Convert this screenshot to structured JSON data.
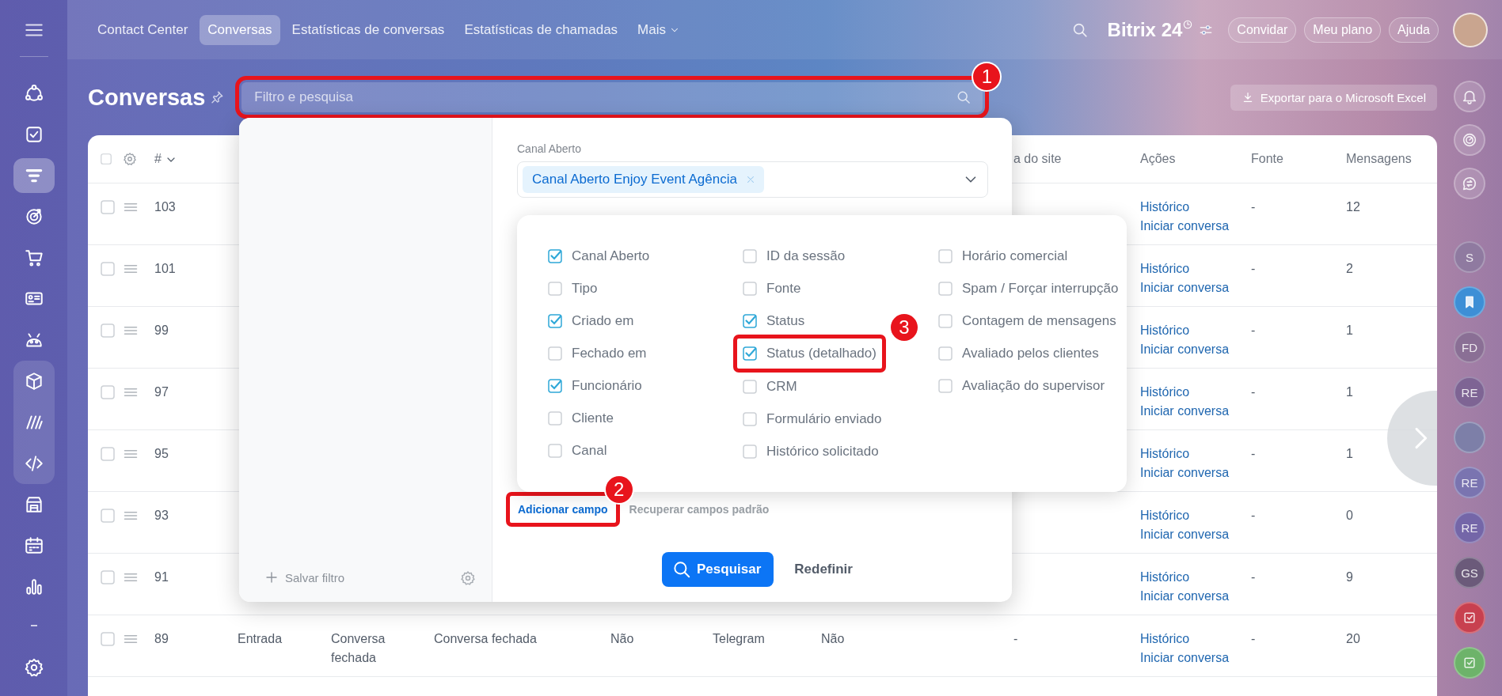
{
  "top_bar": {
    "tabs": [
      {
        "label": "Contact Center",
        "selected": false,
        "kind": "tab"
      },
      {
        "label": "Conversas",
        "selected": true,
        "kind": "tab"
      },
      {
        "label": "Estatísticas de conversas",
        "selected": false,
        "kind": "tab"
      },
      {
        "label": "Estatísticas de chamadas",
        "selected": false,
        "kind": "tab"
      },
      {
        "label": "Mais",
        "selected": false,
        "kind": "menu"
      }
    ],
    "logo": "Bitrix 24",
    "buttons": [
      "Convidar",
      "Meu plano",
      "Ajuda"
    ]
  },
  "left_sidebar": {
    "items": [
      {
        "selected": false,
        "grouped": false
      },
      {
        "selected": false,
        "grouped": false
      },
      {
        "selected": true,
        "grouped": false
      },
      {
        "selected": false,
        "grouped": false
      },
      {
        "selected": false,
        "grouped": false
      },
      {
        "selected": false,
        "grouped": false
      },
      {
        "selected": false,
        "grouped": false
      },
      {
        "selected": false,
        "grouped": true
      },
      {
        "selected": false,
        "grouped": true
      },
      {
        "selected": false,
        "grouped": true
      },
      {
        "selected": false,
        "grouped": false
      },
      {
        "selected": false,
        "grouped": false
      },
      {
        "selected": false,
        "grouped": false
      }
    ]
  },
  "right_sidebar": {
    "items": [
      {
        "kind": "bell"
      },
      {
        "kind": "swirl"
      },
      {
        "kind": "chat"
      },
      {
        "kind": "initials",
        "text": "S",
        "color": "#8f7aa0"
      },
      {
        "kind": "bookmark",
        "color": "#3d8fd6"
      },
      {
        "kind": "initials",
        "text": "FD",
        "color": "#8a6f95"
      },
      {
        "kind": "initials",
        "text": "RE",
        "color": "#7e6494"
      },
      {
        "kind": "photo",
        "color": "#7d7fa8"
      },
      {
        "kind": "initials",
        "text": "RE",
        "color": "#7a74b0"
      },
      {
        "kind": "initials",
        "text": "RE",
        "color": "#7466a8"
      },
      {
        "kind": "initials",
        "text": "GS",
        "color": "#6b5a7a"
      },
      {
        "kind": "task",
        "color": "#c8404f"
      },
      {
        "kind": "task",
        "color": "#6db36a"
      }
    ]
  },
  "page_header": {
    "title": "Conversas",
    "filter": {
      "placeholder": "Filtro e pesquisa",
      "callout": "1"
    },
    "export_button": "Exportar para o Microsoft Excel"
  },
  "table": {
    "select_all": {
      "checked": false
    },
    "columns": [
      "#",
      "a do site",
      "Ações",
      "Fonte",
      "Mensagens"
    ],
    "rows": [
      {
        "selected": false,
        "number": "103",
        "actions": [
          "Histórico",
          "Iniciar conversa"
        ],
        "source": "-",
        "messages": "12"
      },
      {
        "selected": false,
        "number": "101",
        "actions": [
          "Histórico",
          "Iniciar conversa"
        ],
        "source": "-",
        "messages": "2"
      },
      {
        "selected": false,
        "number": "99",
        "actions": [
          "Histórico",
          "Iniciar conversa"
        ],
        "source": "-",
        "messages": "1"
      },
      {
        "selected": false,
        "number": "97",
        "actions": [
          "Histórico",
          "Iniciar conversa"
        ],
        "source": "-",
        "messages": "1"
      },
      {
        "selected": false,
        "number": "95",
        "actions": [
          "Histórico",
          "Iniciar conversa"
        ],
        "source": "-",
        "messages": "1"
      },
      {
        "selected": false,
        "number": "93",
        "actions": [
          "Histórico",
          "Iniciar conversa"
        ],
        "source": "-",
        "messages": "0"
      },
      {
        "selected": false,
        "number": "91",
        "actions": [
          "Histórico",
          "Iniciar conversa"
        ],
        "source": "-",
        "messages": "9"
      },
      {
        "selected": false,
        "number": "89",
        "cells": [
          "Entrada",
          "Conversa fechada",
          "Conversa fechada",
          "Não",
          "Telegram",
          "Não"
        ],
        "site": "-",
        "actions": [
          "Histórico",
          "Iniciar conversa"
        ],
        "source": "-",
        "messages": "20"
      }
    ]
  },
  "filter_popup": {
    "save_filter": "Salvar filtro",
    "field": {
      "label": "Canal Aberto",
      "chips": [
        "Canal Aberto Enjoy Event Agência"
      ]
    },
    "field_menu": {
      "columns": [
        [
          {
            "label": "Canal Aberto",
            "checked": true
          },
          {
            "label": "Tipo",
            "checked": false
          },
          {
            "label": "Criado em",
            "checked": true
          },
          {
            "label": "Fechado em",
            "checked": false
          },
          {
            "label": "Funcionário",
            "checked": true
          },
          {
            "label": "Cliente",
            "checked": false
          },
          {
            "label": "Canal",
            "checked": false
          }
        ],
        [
          {
            "label": "ID da sessão",
            "checked": false
          },
          {
            "label": "Fonte",
            "checked": false
          },
          {
            "label": "Status",
            "checked": true
          },
          {
            "label": "Status (detalhado)",
            "checked": true,
            "callout": "3"
          },
          {
            "label": "CRM",
            "checked": false
          },
          {
            "label": "Formulário enviado",
            "checked": false
          },
          {
            "label": "Histórico solicitado",
            "checked": false
          }
        ],
        [
          {
            "label": "Horário comercial",
            "checked": false
          },
          {
            "label": "Spam / Forçar interrupção",
            "checked": false
          },
          {
            "label": "Contagem de mensagens",
            "checked": false
          },
          {
            "label": "Avaliado pelos clientes",
            "checked": false
          },
          {
            "label": "Avaliação do supervisor",
            "checked": false
          }
        ]
      ]
    },
    "add_field": {
      "label": "Adicionar campo",
      "callout": "2"
    },
    "restore_fields": "Recuperar campos padrão",
    "search_button": "Pesquisar",
    "reset_button": "Redefinir"
  }
}
